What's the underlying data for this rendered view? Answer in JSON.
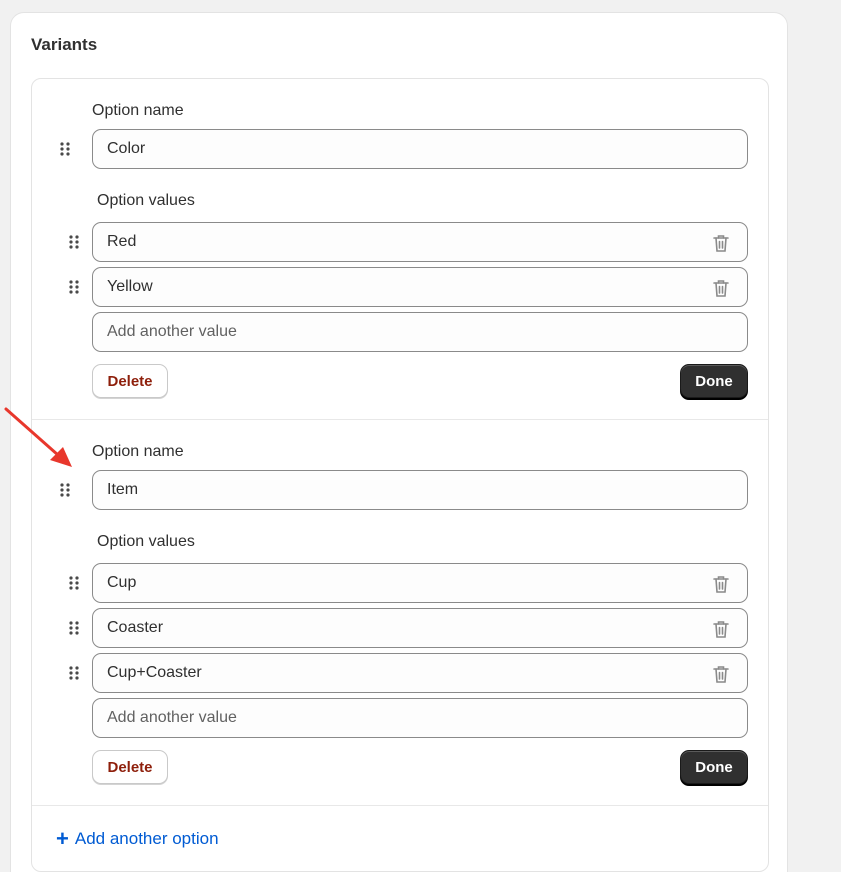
{
  "card": {
    "title": "Variants"
  },
  "options": [
    {
      "name_label": "Option name",
      "name_value": "Color",
      "values_label": "Option values",
      "values": [
        "Red",
        "Yellow"
      ],
      "add_placeholder": "Add another value",
      "delete_label": "Delete",
      "done_label": "Done"
    },
    {
      "name_label": "Option name",
      "name_value": "Item",
      "values_label": "Option values",
      "values": [
        "Cup",
        "Coaster",
        "Cup+Coaster"
      ],
      "add_placeholder": "Add another value",
      "delete_label": "Delete",
      "done_label": "Done"
    }
  ],
  "add_option_label": "Add another option",
  "colors": {
    "accent": "#005bd3",
    "danger": "#8e1f0b",
    "primary_button": "#303030",
    "annotation_arrow": "#e8372c"
  },
  "icons": {
    "drag": "drag-handle-icon",
    "delete": "trash-icon",
    "add": "plus-icon"
  }
}
